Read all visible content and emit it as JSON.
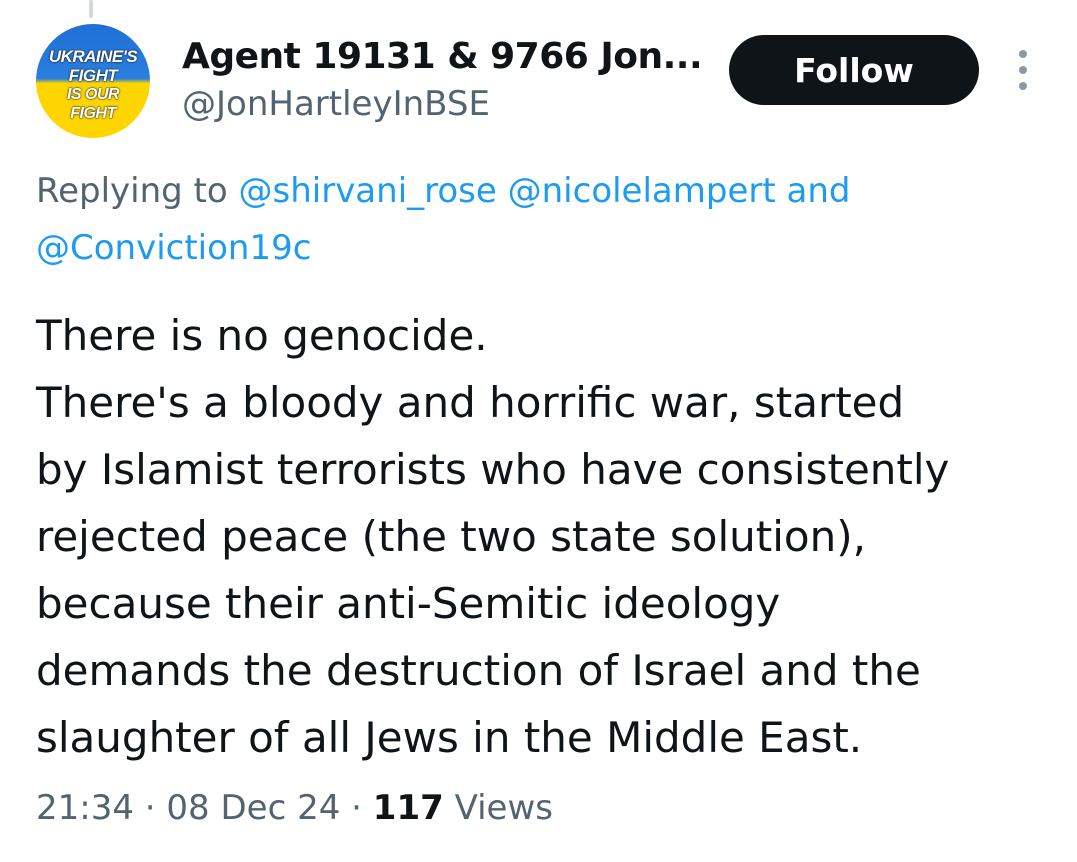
{
  "author": {
    "display_name": "Agent 19131 & 9766 Jon...",
    "handle": "@JonHartleyInBSE",
    "avatar_text": [
      "UKRAINE'S",
      "FIGHT",
      "IS OUR",
      "FIGHT"
    ]
  },
  "follow_label": "Follow",
  "reply": {
    "prefix": "Replying to",
    "mentions": [
      "@shirvani_rose",
      "@nicolelampert",
      "@Conviction19c"
    ],
    "joiner": "and"
  },
  "tweet_lines": [
    "There is no genocide.",
    "There's a bloody and horrific war, started",
    "by Islamist terrorists who have consistently",
    "rejected peace (the two state solution),",
    "because their anti-Semitic ideology",
    "demands the destruction of Israel and the",
    "slaughter of all Jews in the Middle East."
  ],
  "meta": {
    "time": "21:34",
    "separator": "·",
    "date": "08 Dec 24",
    "views_count": "117",
    "views_label": "Views"
  },
  "colors": {
    "text": "#0f1419",
    "secondary": "#536471",
    "link": "#1d9bf0",
    "button_bg": "#0f1419",
    "avatar_blue": "#2b7fe0",
    "avatar_yellow": "#ffd500"
  },
  "icons": {
    "more": "more-vertical-icon"
  }
}
